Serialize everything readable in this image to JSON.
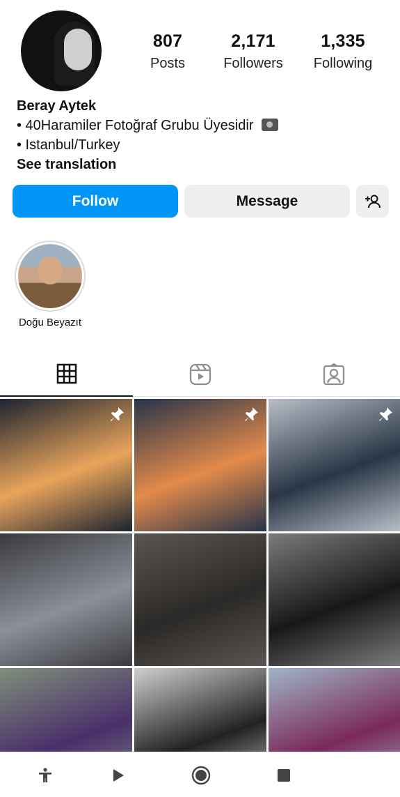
{
  "profile": {
    "stats": [
      {
        "value": "807",
        "label": "Posts"
      },
      {
        "value": "2,171",
        "label": "Followers"
      },
      {
        "value": "1,335",
        "label": "Following"
      }
    ],
    "name": "Beray Aytek",
    "bio_lines": [
      "• 40Haramiler Fotoğraf Grubu Üyesidir",
      "• Istanbul/Turkey"
    ],
    "see_translation": "See translation"
  },
  "actions": {
    "follow": "Follow",
    "message": "Message"
  },
  "highlights": [
    {
      "label": "Doğu Beyazıt"
    }
  ],
  "tabs": [
    "grid-icon",
    "reels-icon",
    "tagged-icon"
  ],
  "grid_posts": [
    {
      "pinned": true,
      "colors": [
        "#1c2430",
        "#e9a45b"
      ]
    },
    {
      "pinned": true,
      "colors": [
        "#263449",
        "#e38a4a"
      ]
    },
    {
      "pinned": true,
      "colors": [
        "#b7bec7",
        "#2a3646"
      ]
    },
    {
      "pinned": false,
      "colors": [
        "#3b3b3e",
        "#8a8f99"
      ]
    },
    {
      "pinned": false,
      "colors": [
        "#5a5552",
        "#2b2927"
      ]
    },
    {
      "pinned": false,
      "colors": [
        "#7b7b7d",
        "#181818"
      ]
    },
    {
      "pinned": false,
      "colors": [
        "#7f8f7a",
        "#4b2f6b"
      ]
    },
    {
      "pinned": false,
      "colors": [
        "#cfcfcf",
        "#222222"
      ]
    },
    {
      "pinned": false,
      "colors": [
        "#9fb5c6",
        "#7a2a5a"
      ]
    }
  ],
  "bottom_nav": [
    "accessibility-icon",
    "play-icon",
    "record-icon",
    "stop-icon"
  ]
}
